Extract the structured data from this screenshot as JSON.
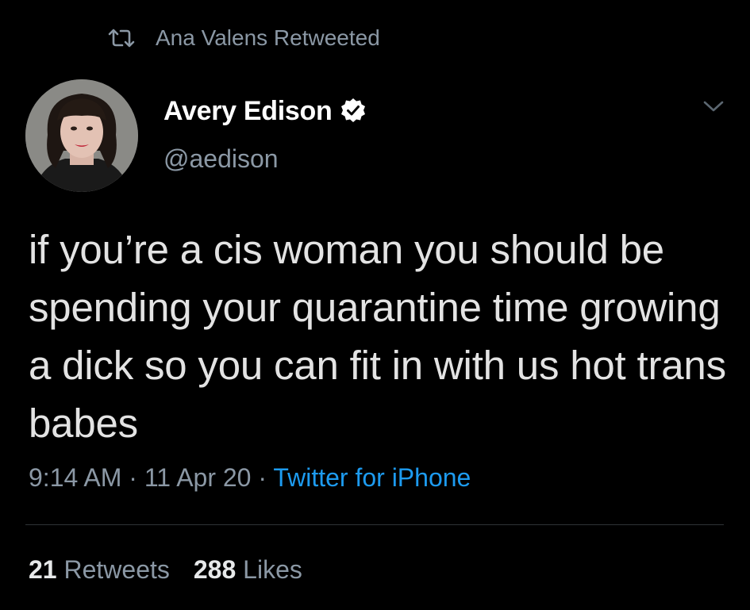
{
  "retweet_context": {
    "icon": "retweet-icon",
    "text": "Ana Valens Retweeted"
  },
  "author": {
    "display_name": "Avery Edison",
    "handle": "@aedison",
    "verified": true,
    "avatar_icon": "avatar"
  },
  "tweet": {
    "text": "if you’re a cis woman you should be spending your quarantine time growing a dick so you can fit in with us hot trans babes",
    "time": "9:14 AM",
    "date": "11 Apr 20",
    "separator": "·",
    "source": "Twitter for iPhone"
  },
  "stats": {
    "retweets_count": "21",
    "retweets_label": "Retweets",
    "likes_count": "288",
    "likes_label": "Likes"
  },
  "colors": {
    "background": "#000000",
    "primary_text": "#e3e3e3",
    "secondary_text": "#8b98a5",
    "link": "#1d9bf0",
    "divider": "#2f3336"
  }
}
